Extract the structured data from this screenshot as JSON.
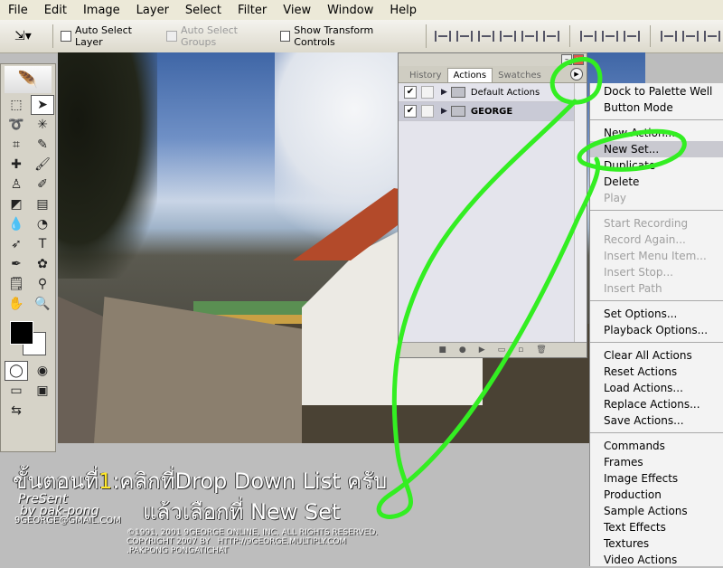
{
  "menubar": {
    "items": [
      "File",
      "Edit",
      "Image",
      "Layer",
      "Select",
      "Filter",
      "View",
      "Window",
      "Help"
    ]
  },
  "options_bar": {
    "tool_icon": "move-tool-icon",
    "auto_select_layer": "Auto Select Layer",
    "auto_select_groups": "Auto Select Groups",
    "show_transform_controls": "Show Transform Controls"
  },
  "actions_panel": {
    "tabs": [
      "History",
      "Actions",
      "Swatches"
    ],
    "active_tab": "Actions",
    "rows": [
      {
        "label": "Default Actions",
        "checked": "✔"
      },
      {
        "label": "GEORGE",
        "checked": "✔"
      }
    ],
    "footer_icons": [
      "■",
      "●",
      "▶",
      "▭",
      "▫",
      "🗑"
    ]
  },
  "flyout_menu": {
    "group1": [
      "Dock to Palette Well",
      "Button Mode"
    ],
    "group2": [
      "New Action...",
      "New Set...",
      "Duplicate",
      "Delete",
      "Play"
    ],
    "group3": [
      "Start Recording",
      "Record Again...",
      "Insert Menu Item...",
      "Insert Stop...",
      "Insert Path"
    ],
    "group4": [
      "Set Options...",
      "Playback Options..."
    ],
    "group5": [
      "Clear All Actions",
      "Reset Actions",
      "Load Actions...",
      "Replace Actions...",
      "Save Actions..."
    ],
    "group6": [
      "Commands",
      "Frames",
      "Image Effects",
      "Production",
      "Sample Actions",
      "Text Effects",
      "Textures",
      "Video Actions"
    ],
    "highlighted": "New Set...",
    "disabled": [
      "Play",
      "Start Recording",
      "Record Again...",
      "Insert Menu Item...",
      "Insert Stop...",
      "Insert Path"
    ]
  },
  "caption": {
    "line1_prefix": "ขั้นตอนที่",
    "line1_num": "1",
    "line1_text": ":คลิกที่Drop Down List ครับ",
    "line2": "แล้วเลือกที่ New Set"
  },
  "signature": {
    "present": "PreSent",
    "by": "by pak-pong",
    "email": "9GEORGE@GMAIL.COM"
  },
  "copyright": {
    "line1": "©1991, 2001 9GEORGE ONLINE, INC. ALL RIGHTS RESERVED.",
    "line2": "COPYRIGHT 2007 BY   HTTP://9GEORGE.MULTIPLY.COM",
    "line3": ".PAKPONG PONGATICHAT"
  },
  "colors": {
    "annotation_green": "#33ee22",
    "caption_yellow": "#ffe82a"
  }
}
